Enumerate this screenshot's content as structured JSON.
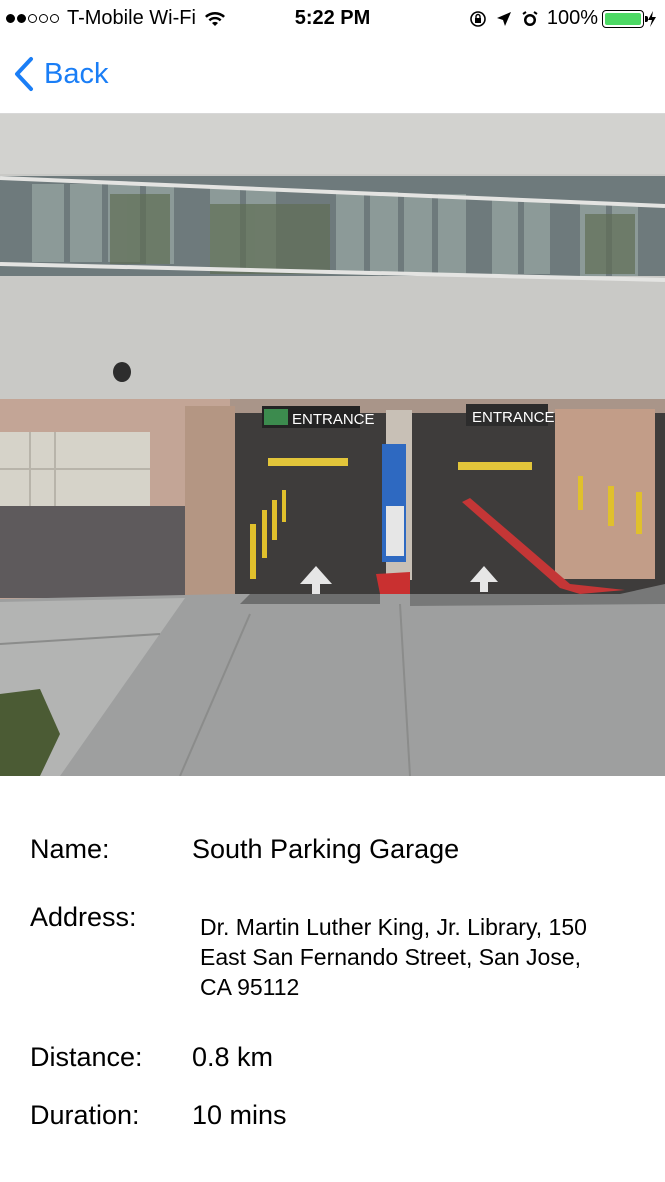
{
  "status_bar": {
    "carrier": "T-Mobile Wi-Fi",
    "time": "5:22 PM",
    "battery_percent": "100%",
    "signal_bars_filled": 2,
    "signal_bars_total": 5,
    "icons": [
      "wifi-icon",
      "orientation-lock-icon",
      "location-arrow-icon",
      "alarm-icon",
      "battery-icon",
      "charging-bolt-icon"
    ]
  },
  "nav": {
    "back_label": "Back",
    "accent_color": "#1a7ef6"
  },
  "photo": {
    "description_icon": "parking-garage-entrance-photo",
    "signs": [
      "ENTRANCE",
      "ENTRANCE"
    ]
  },
  "details": {
    "name_label": "Name:",
    "name_value": "South Parking Garage",
    "address_label": "Address:",
    "address_line1": "Dr. Martin Luther King, Jr. Library, 150",
    "address_line2": "East San Fernando Street, San Jose,",
    "address_line3": "CA 95112",
    "distance_label": "Distance:",
    "distance_value": "0.8 km",
    "duration_label": "Duration:",
    "duration_value": "10 mins"
  }
}
